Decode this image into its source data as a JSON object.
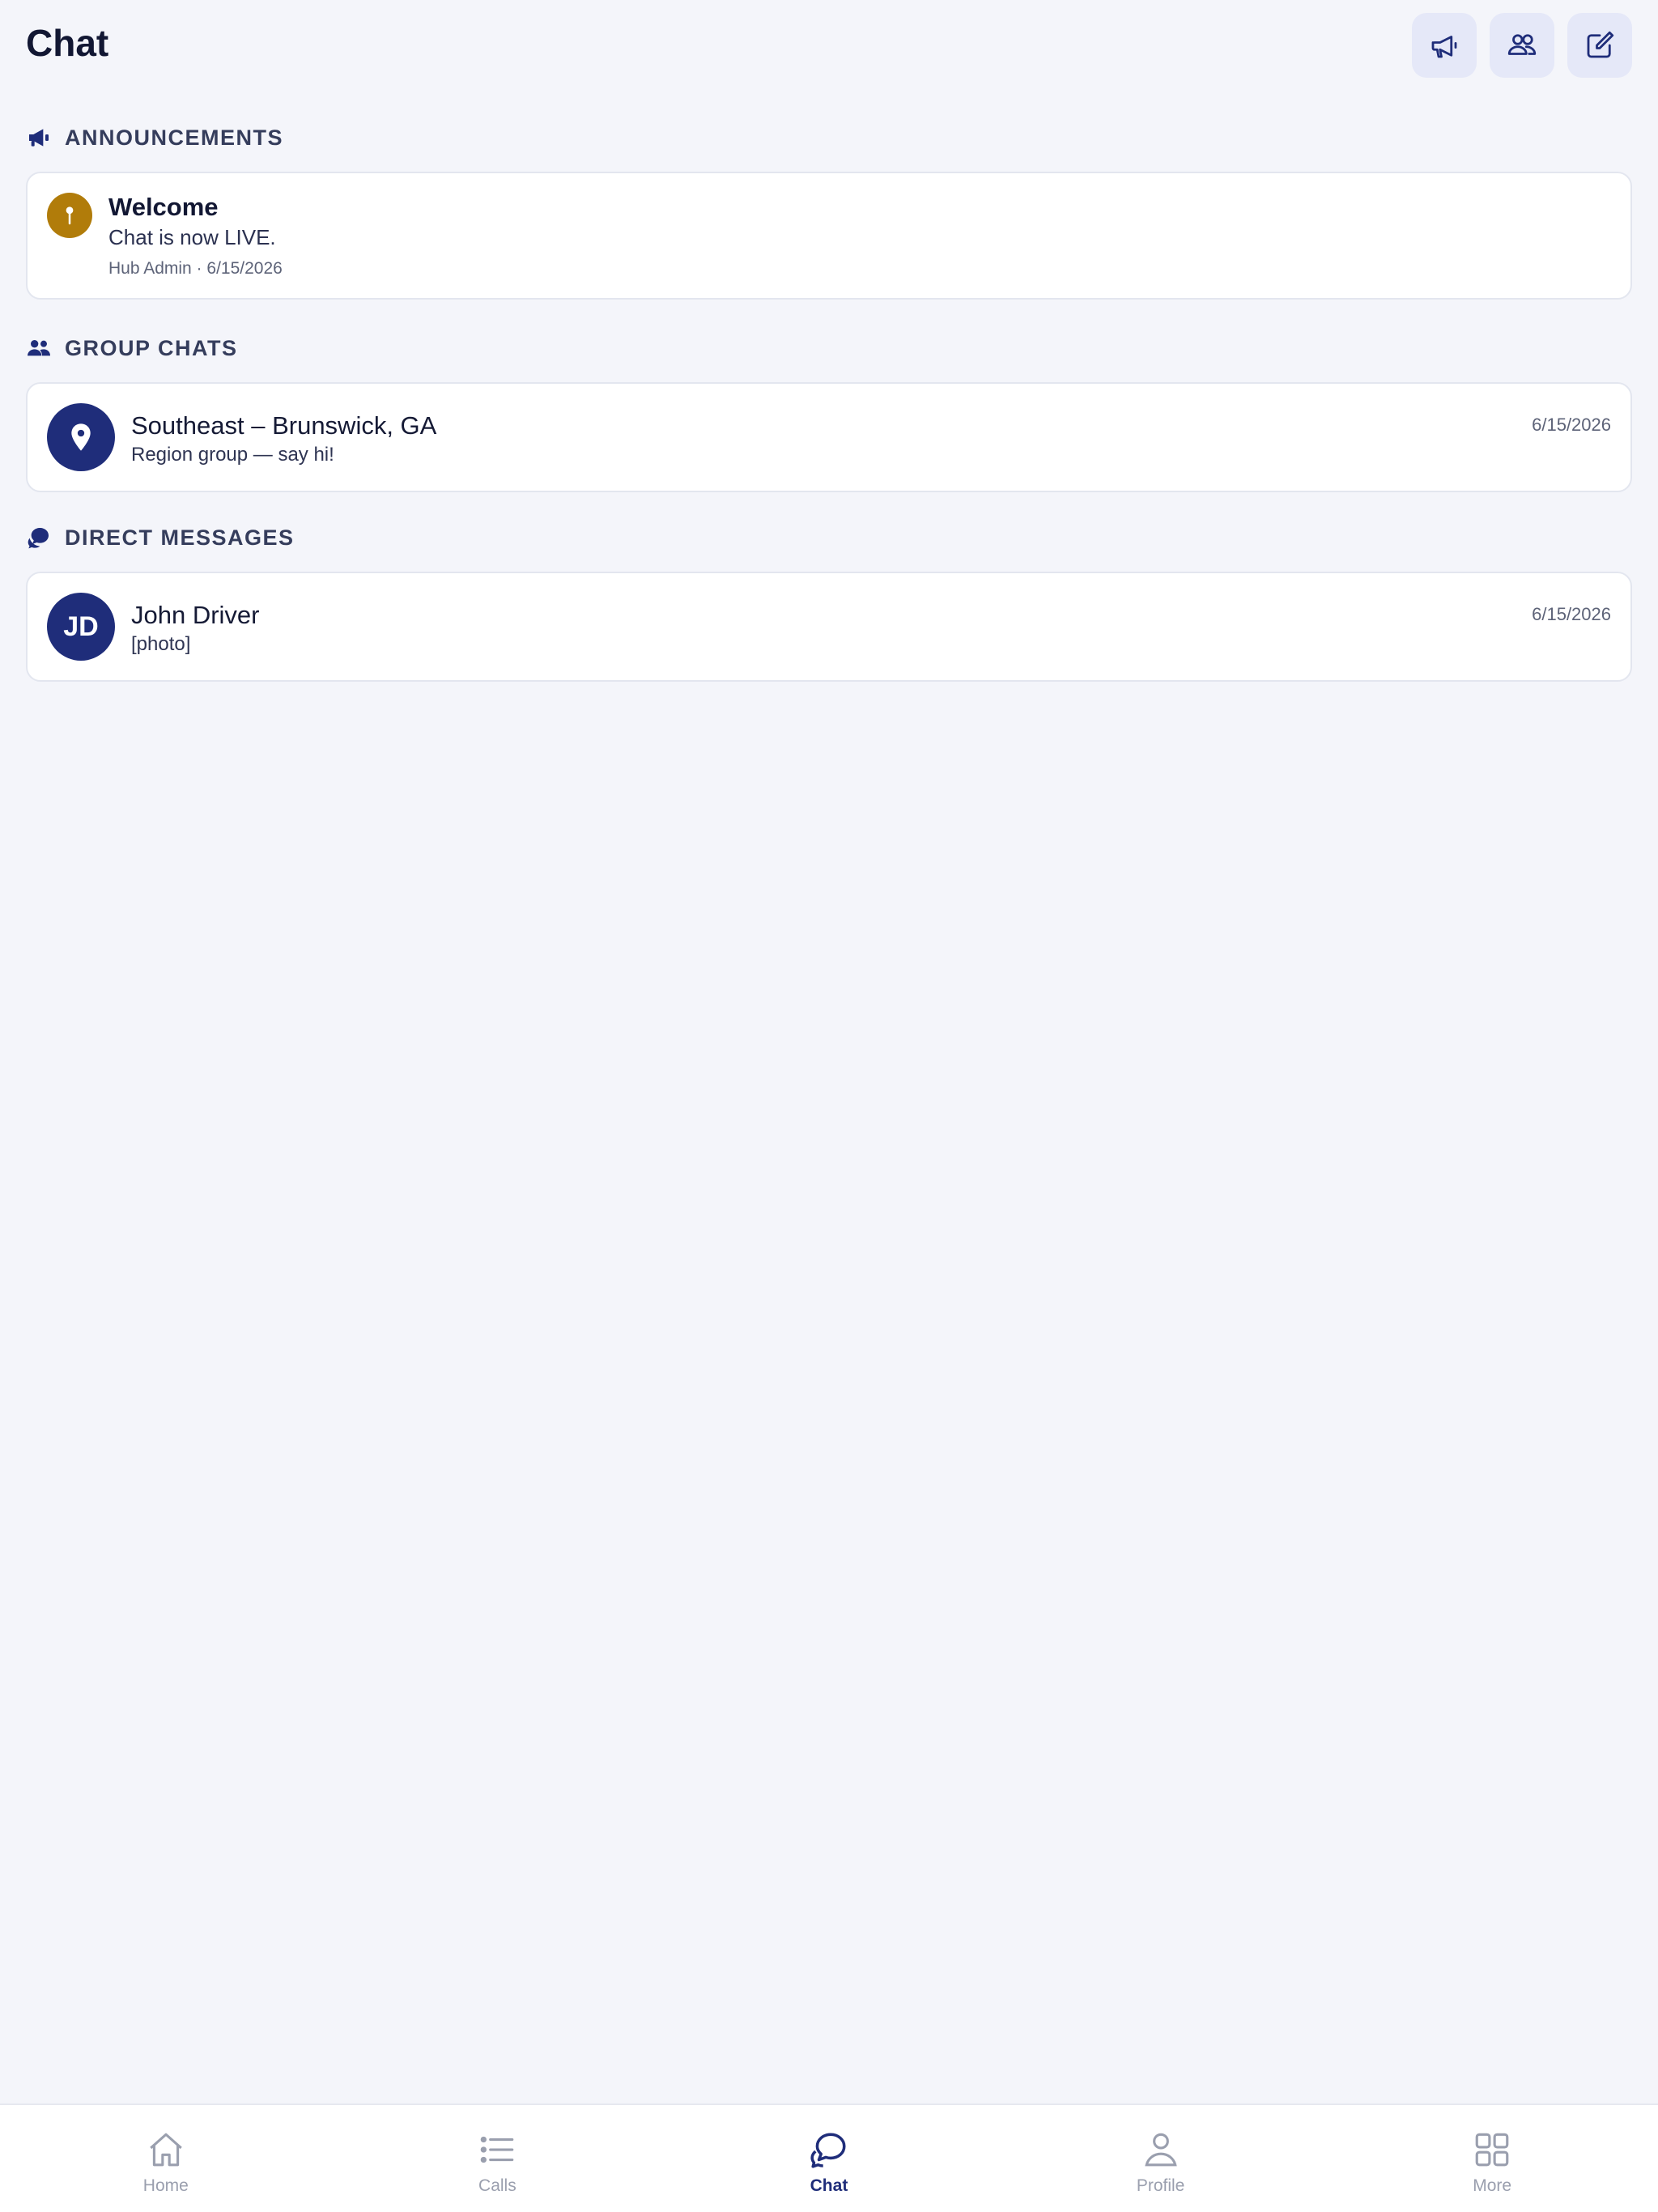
{
  "header": {
    "title": "Chat",
    "actions": [
      {
        "name": "megaphone-icon"
      },
      {
        "name": "users-icon"
      },
      {
        "name": "compose-icon"
      }
    ]
  },
  "announcements": {
    "section_title": "Announcements",
    "icon": "megaphone-icon",
    "items": [
      {
        "icon": "pin-icon",
        "title": "Welcome",
        "body": "Chat is now LIVE.",
        "meta": "Hub Admin · 6/15/2026"
      }
    ]
  },
  "group_chats": {
    "section_title": "Group Chats",
    "icon": "users-icon",
    "items": [
      {
        "avatar_icon": "location-pin-icon",
        "name": "Southeast – Brunswick, GA",
        "preview": "Region group — say hi!",
        "date": "6/15/2026"
      }
    ]
  },
  "direct_messages": {
    "section_title": "Direct Messages",
    "icon": "chat-bubbles-icon",
    "items": [
      {
        "initials": "JD",
        "name": "John Driver",
        "preview": "[photo]",
        "date": "6/15/2026"
      }
    ]
  },
  "nav": {
    "items": [
      {
        "label": "Home",
        "icon": "home-icon",
        "active": false
      },
      {
        "label": "Calls",
        "icon": "list-icon",
        "active": false
      },
      {
        "label": "Chat",
        "icon": "chat-icon",
        "active": true
      },
      {
        "label": "Profile",
        "icon": "person-icon",
        "active": false
      },
      {
        "label": "More",
        "icon": "grid-icon",
        "active": false
      }
    ]
  },
  "colors": {
    "background": "#f4f5fa",
    "accent": "#1f2d7a",
    "announcement_accent": "#b17c0a",
    "header_button_bg": "#e5e8f8"
  }
}
